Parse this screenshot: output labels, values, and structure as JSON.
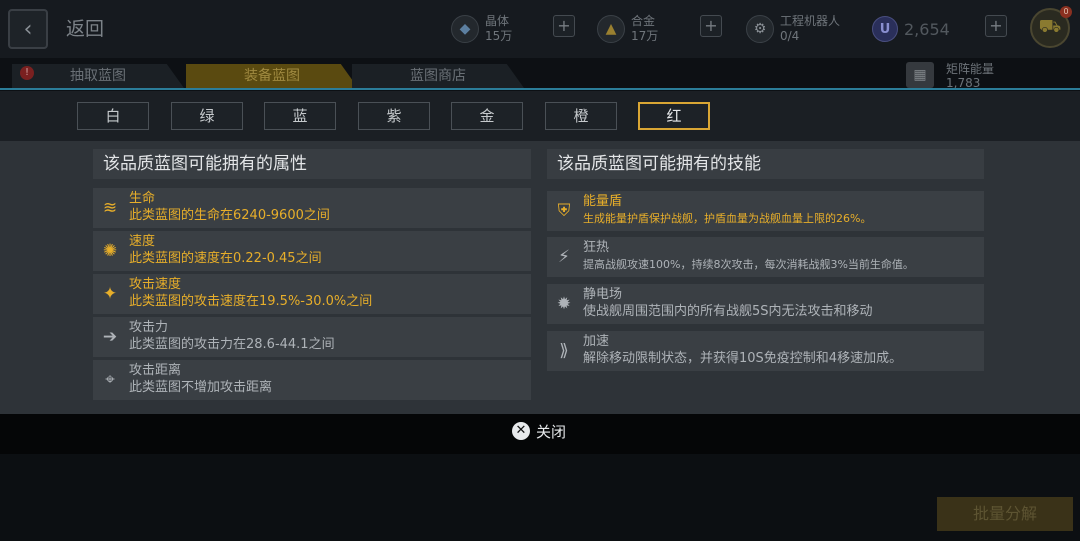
{
  "header": {
    "back_label": "返回",
    "resources": [
      {
        "name": "晶体",
        "value": "15万",
        "icon": "crystal-icon"
      },
      {
        "name": "合金",
        "value": "17万",
        "icon": "alloy-icon"
      },
      {
        "name": "工程机器人",
        "value": "0/4",
        "icon": "robot-icon"
      }
    ],
    "currency_icon": "U",
    "currency_value": "2,654",
    "cart_badge": "0"
  },
  "tabs": [
    {
      "label": "抽取蓝图",
      "active": false
    },
    {
      "label": "装备蓝图",
      "active": true
    },
    {
      "label": "蓝图商店",
      "active": false
    }
  ],
  "matrix_energy": {
    "label": "矩阵能量",
    "value": "1,783"
  },
  "modal": {
    "qualities": [
      {
        "label": "白",
        "selected": false
      },
      {
        "label": "绿",
        "selected": false
      },
      {
        "label": "蓝",
        "selected": false
      },
      {
        "label": "紫",
        "selected": false
      },
      {
        "label": "金",
        "selected": false
      },
      {
        "label": "橙",
        "selected": false
      },
      {
        "label": "红",
        "selected": true
      }
    ],
    "attributes_title": "该品质蓝图可能拥有的属性",
    "skills_title": "该品质蓝图可能拥有的技能",
    "attributes": [
      {
        "name": "生命",
        "desc": "此类蓝图的生命在6240-9600之间",
        "icon": "health-icon",
        "highlight": true
      },
      {
        "name": "速度",
        "desc": "此类蓝图的速度在0.22-0.45之间",
        "icon": "speed-icon",
        "highlight": true
      },
      {
        "name": "攻击速度",
        "desc": "此类蓝图的攻击速度在19.5%-30.0%之间",
        "icon": "attack-speed-icon",
        "highlight": true
      },
      {
        "name": "攻击力",
        "desc": "此类蓝图的攻击力在28.6-44.1之间",
        "icon": "arrow-right-icon",
        "highlight": false
      },
      {
        "name": "攻击距离",
        "desc": "此类蓝图不增加攻击距离",
        "icon": "crosshair-icon",
        "highlight": false
      }
    ],
    "skills": [
      {
        "name": "能量盾",
        "desc": "生成能量护盾保护战舰，护盾血量为战舰血量上限的26%。",
        "icon": "shield-icon",
        "highlight": true
      },
      {
        "name": "狂热",
        "desc": "提高战舰攻速100%，持续8次攻击，每次消耗战舰3%当前生命值。",
        "icon": "frenzy-icon",
        "highlight": false
      },
      {
        "name": "静电场",
        "desc": "使战舰周围范围内的所有战舰5S内无法攻击和移动",
        "icon": "static-field-icon",
        "highlight": false
      },
      {
        "name": "加速",
        "desc": "解除移动限制状态，并获得10S免疫控制和4移速加成。",
        "icon": "boost-icon",
        "highlight": false
      }
    ],
    "close_label": "关闭"
  },
  "footer": {
    "batch_label": "批量分解"
  },
  "colors": {
    "accent_gold": "#e7ae2a",
    "selected_border": "#d9a634",
    "divider_cyan": "#2b7d99"
  }
}
